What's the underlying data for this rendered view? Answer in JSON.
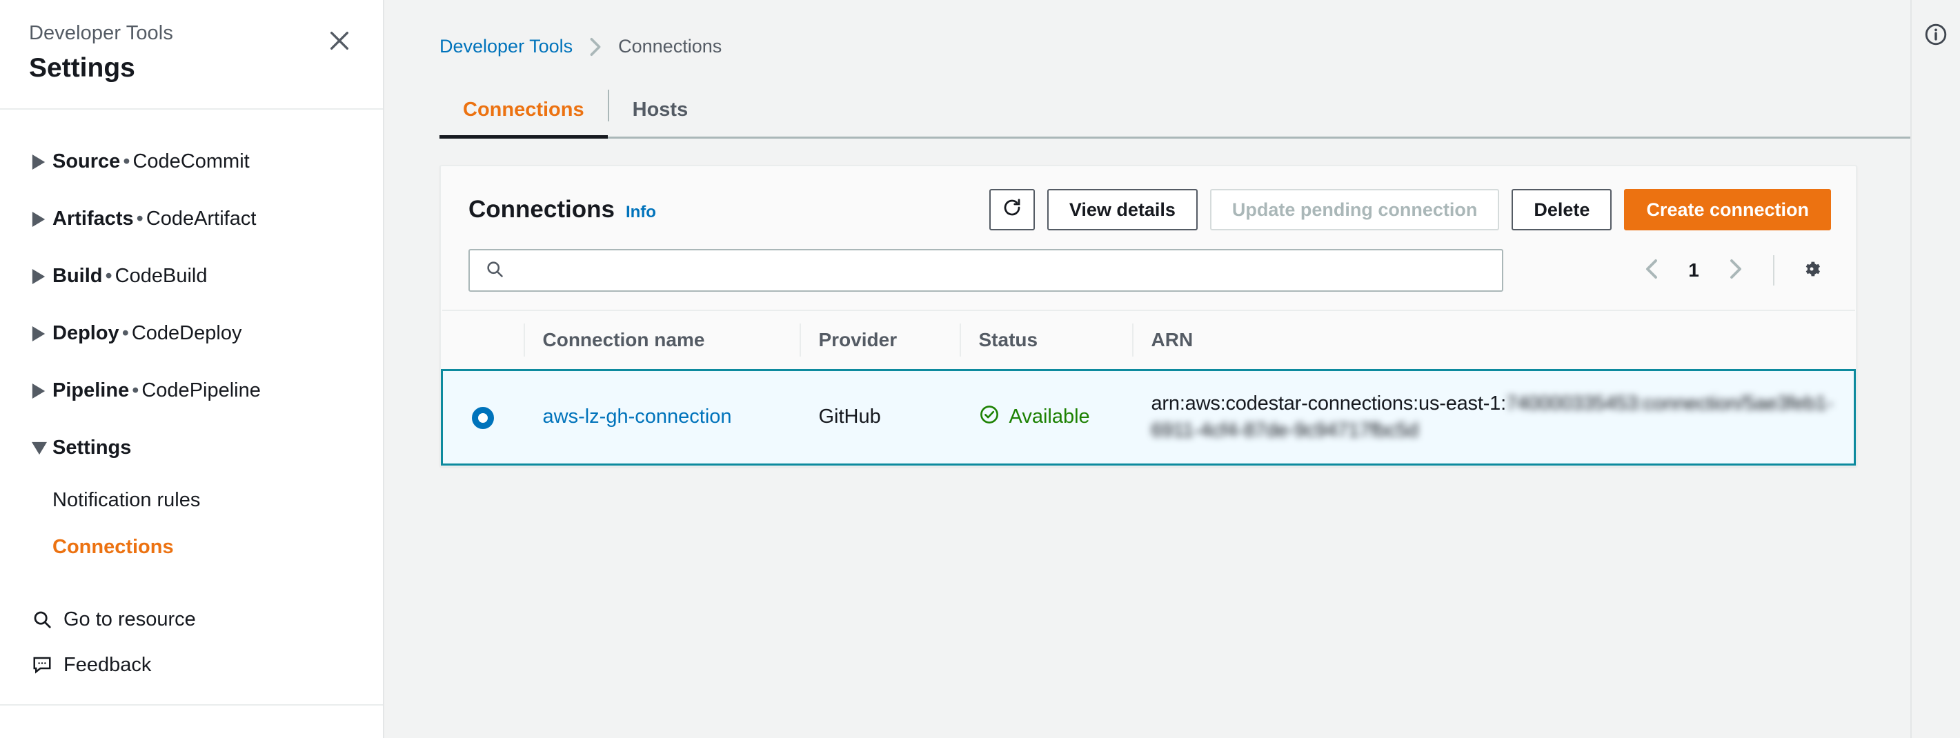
{
  "sidebar": {
    "eyebrow": "Developer Tools",
    "title": "Settings",
    "close_icon": "close-icon",
    "groups": [
      {
        "name": "Source",
        "separator": "•",
        "service": "CodeCommit",
        "expanded": false,
        "caret": "caret-right-icon"
      },
      {
        "name": "Artifacts",
        "separator": "•",
        "service": "CodeArtifact",
        "expanded": false,
        "caret": "caret-right-icon"
      },
      {
        "name": "Build",
        "separator": "•",
        "service": "CodeBuild",
        "expanded": false,
        "caret": "caret-right-icon"
      },
      {
        "name": "Deploy",
        "separator": "•",
        "service": "CodeDeploy",
        "expanded": false,
        "caret": "caret-right-icon"
      },
      {
        "name": "Pipeline",
        "separator": "•",
        "service": "CodePipeline",
        "expanded": false,
        "caret": "caret-right-icon"
      },
      {
        "name": "Settings",
        "separator": "",
        "service": "",
        "expanded": true,
        "caret": "caret-down-icon"
      }
    ],
    "sub_items": [
      {
        "label": "Notification rules",
        "active": false
      },
      {
        "label": "Connections",
        "active": true
      }
    ],
    "tools": [
      {
        "label": "Go to resource",
        "icon": "search-icon"
      },
      {
        "label": "Feedback",
        "icon": "feedback-icon"
      }
    ]
  },
  "breadcrumb": {
    "root": "Developer Tools",
    "separator": "chevron-right-icon",
    "current": "Connections"
  },
  "tabs": [
    {
      "label": "Connections",
      "active": true
    },
    {
      "label": "Hosts",
      "active": false
    }
  ],
  "card": {
    "title": "Connections",
    "info_label": "Info",
    "buttons": {
      "refresh": {
        "label": "",
        "icon": "refresh-icon",
        "disabled": false
      },
      "view_details": {
        "label": "View details",
        "disabled": false
      },
      "update_pending": {
        "label": "Update pending connection",
        "disabled": true
      },
      "delete": {
        "label": "Delete",
        "disabled": false
      },
      "create": {
        "label": "Create connection",
        "disabled": false,
        "primary": true
      }
    },
    "search": {
      "icon": "search-icon",
      "value": "",
      "placeholder": ""
    },
    "pagination": {
      "prev_icon": "chevron-left-icon",
      "page": "1",
      "next_icon": "chevron-right-icon",
      "settings_icon": "gear-icon"
    },
    "table": {
      "columns": [
        "",
        "Connection name",
        "Provider",
        "Status",
        "ARN"
      ],
      "rows": [
        {
          "selected": true,
          "name": "aws-lz-gh-connection",
          "provider": "GitHub",
          "status": {
            "label": "Available",
            "icon": "check-circle-icon"
          },
          "arn_visible": "arn:aws:codestar-connections:us-east-1:",
          "arn_redacted": "740000335453:connection/5ae3feb1-6911-4cf4-87de-9c94717fbc5d"
        }
      ]
    }
  },
  "right_rail": {
    "info_icon": "info-circle-icon"
  },
  "colors": {
    "accent_orange": "#ec7211",
    "link_blue": "#0073bb",
    "status_green": "#1d8102",
    "selected_border": "#0d8a9e",
    "selected_fill": "#f1faff",
    "page_bg": "#f2f3f3"
  }
}
